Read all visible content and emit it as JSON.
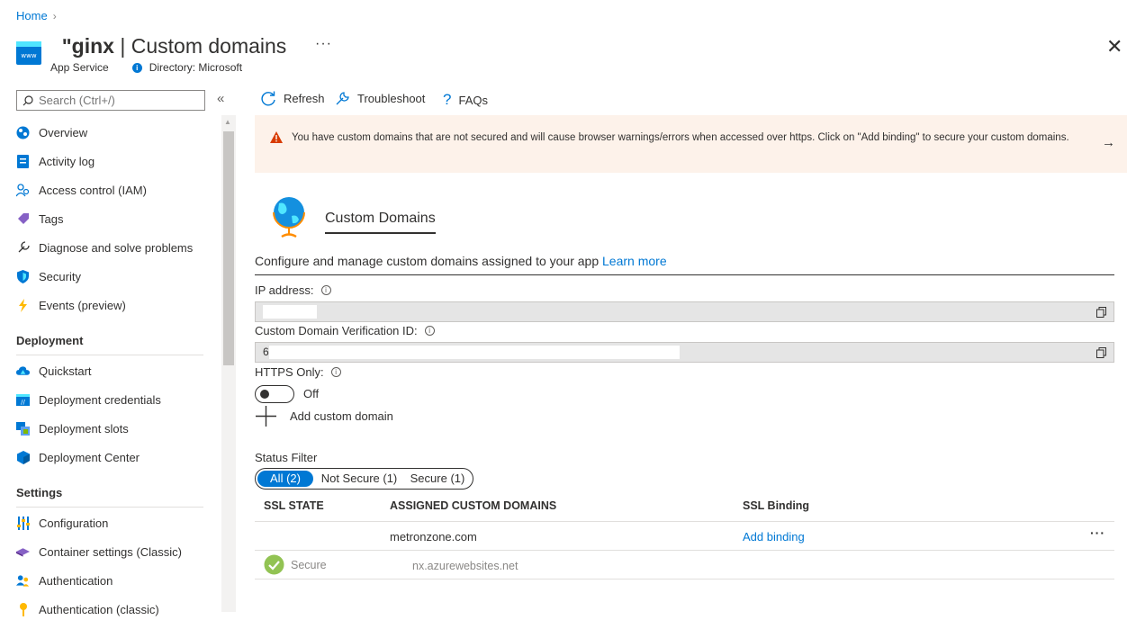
{
  "breadcrumb": {
    "home": "Home"
  },
  "header": {
    "name": "  ʺginx",
    "title": "Custom domains",
    "more": "···",
    "resource_type": "App Service",
    "directory": "Directory: Microsoft",
    "close": "✕"
  },
  "search": {
    "placeholder": "Search (Ctrl+/)"
  },
  "sidebar": {
    "collapse": "«",
    "items": [
      {
        "label": "Overview",
        "icon": "overview-icon"
      },
      {
        "label": "Activity log",
        "icon": "activity-log-icon"
      },
      {
        "label": "Access control (IAM)",
        "icon": "iam-icon"
      },
      {
        "label": "Tags",
        "icon": "tag-icon"
      },
      {
        "label": "Diagnose and solve problems",
        "icon": "wrench-icon"
      },
      {
        "label": "Security",
        "icon": "shield-icon"
      },
      {
        "label": "Events (preview)",
        "icon": "lightning-icon"
      }
    ],
    "deployment_header": "Deployment",
    "deployment_items": [
      {
        "label": "Quickstart",
        "icon": "cloud-icon"
      },
      {
        "label": "Deployment credentials",
        "icon": "credentials-icon"
      },
      {
        "label": "Deployment slots",
        "icon": "slots-icon"
      },
      {
        "label": "Deployment Center",
        "icon": "cube-icon"
      }
    ],
    "settings_header": "Settings",
    "settings_items": [
      {
        "label": "Configuration",
        "icon": "sliders-icon"
      },
      {
        "label": "Container settings (Classic)",
        "icon": "container-icon"
      },
      {
        "label": "Authentication",
        "icon": "people-icon"
      },
      {
        "label": "Authentication (classic)",
        "icon": "key-icon"
      }
    ]
  },
  "toolbar": {
    "refresh": "Refresh",
    "troubleshoot": "Troubleshoot",
    "faqs": "FAQs"
  },
  "banner": {
    "text": "You have custom domains that are not secured and will cause browser warnings/errors when accessed over https. Click on \"Add binding\" to secure your custom domains.",
    "arrow": "→"
  },
  "section": {
    "title": "Custom Domains",
    "description": "Configure and manage custom domains assigned to your app",
    "learn_more": "Learn more"
  },
  "fields": {
    "ip_label": "IP address:",
    "verification_label": "Custom Domain Verification ID:",
    "verification_value_prefix": "6",
    "https_label": "HTTPS Only:",
    "https_state": "Off"
  },
  "add_domain": "Add custom domain",
  "filter": {
    "label": "Status Filter",
    "options": [
      "All (2)",
      "Not Secure (1)",
      "Secure (1)"
    ],
    "active": "All (2)"
  },
  "table": {
    "headers": [
      "SSL STATE",
      "ASSIGNED CUSTOM DOMAINS",
      "SSL Binding"
    ],
    "rows": [
      {
        "ssl_state": "",
        "domain": "metronzone.com",
        "binding": "Add binding",
        "more": "···"
      },
      {
        "ssl_state": "Secure",
        "domain": "nx.azurewebsites.net",
        "binding": ""
      }
    ]
  },
  "colors": {
    "accent": "#0078d4",
    "banner_bg": "#fdf2ea",
    "warning": "#d83b01",
    "success": "#92c353"
  }
}
